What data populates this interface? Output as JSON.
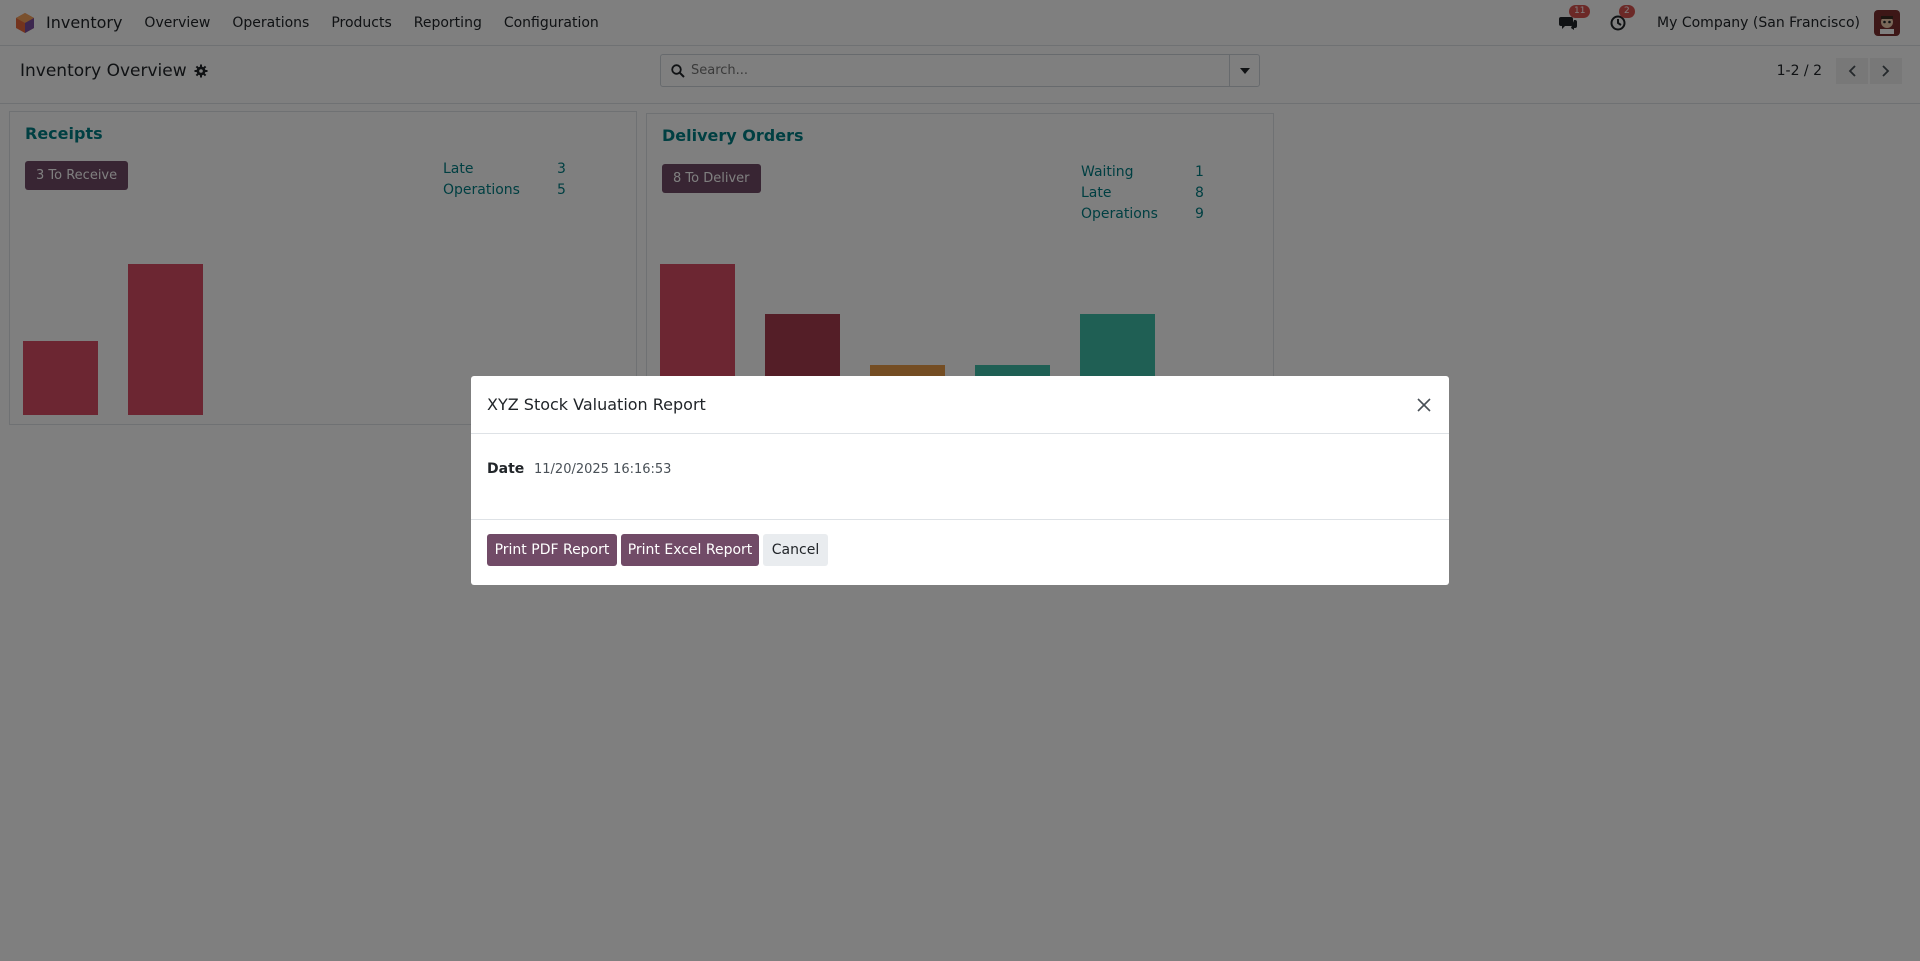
{
  "navbar": {
    "app_name": "Inventory",
    "menu": [
      "Overview",
      "Operations",
      "Products",
      "Reporting",
      "Configuration"
    ],
    "messages_badge": "11",
    "activities_badge": "2",
    "company": "My Company (San Francisco)"
  },
  "control_panel": {
    "title": "Inventory Overview",
    "search_placeholder": "Search...",
    "pager": "1-2 / 2"
  },
  "cards": {
    "receipts": {
      "title": "Receipts",
      "button": "3 To Receive",
      "stats": [
        {
          "label": "Late",
          "value": "3"
        },
        {
          "label": "Operations",
          "value": "5"
        }
      ],
      "bar_values": [
        0.49,
        1.0
      ],
      "bar_colors": [
        "#d94c64",
        "#d94c64"
      ]
    },
    "delivery": {
      "title": "Delivery Orders",
      "button": "8 To Deliver",
      "stats": [
        {
          "label": "Waiting",
          "value": "1"
        },
        {
          "label": "Late",
          "value": "8"
        },
        {
          "label": "Operations",
          "value": "9"
        }
      ],
      "bar_values": [
        1.0,
        0.67,
        0.33,
        0.33,
        0.67
      ],
      "bar_colors": [
        "#d94c64",
        "#a83c4e",
        "#e89a47",
        "#3fbfa8",
        "#3fbfa8"
      ]
    }
  },
  "modal": {
    "title": "XYZ Stock Valuation Report",
    "date_label": "Date",
    "date_value": "11/20/2025 16:16:53",
    "print_pdf": "Print PDF Report",
    "print_excel": "Print Excel Report",
    "cancel": "Cancel"
  },
  "colors": {
    "primary": "#714b67",
    "teal": "#017e84",
    "badge": "#d9534f"
  }
}
